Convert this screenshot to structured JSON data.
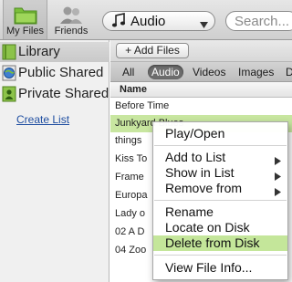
{
  "toolbar": {
    "my_files_label": "My Files",
    "friends_label": "Friends",
    "type_selector_value": "Audio",
    "search_placeholder": "Search..."
  },
  "sidebar": {
    "items": [
      {
        "label": "Library",
        "icon": "library-icon",
        "selected": true
      },
      {
        "label": "Public Shared",
        "icon": "public-shared-icon",
        "selected": false
      },
      {
        "label": "Private Shared",
        "icon": "private-shared-icon",
        "selected": false
      }
    ],
    "create_list_label": "Create List"
  },
  "main": {
    "add_files_label": "+ Add Files",
    "filter_tabs": [
      {
        "label": "All",
        "active": false
      },
      {
        "label": "Audio",
        "active": true
      },
      {
        "label": "Videos",
        "active": false
      },
      {
        "label": "Images",
        "active": false
      },
      {
        "label": "D",
        "active": false
      }
    ],
    "column_header": "Name",
    "files": [
      {
        "name": "Before Time",
        "selected": false
      },
      {
        "name": "Junkyard Blues",
        "selected": true
      },
      {
        "name": "things",
        "selected": false
      },
      {
        "name": "Kiss To",
        "selected": false
      },
      {
        "name": "Frame",
        "selected": false
      },
      {
        "name": "Europa",
        "selected": false
      },
      {
        "name": "Lady o",
        "selected": false
      },
      {
        "name": "02 A D",
        "selected": false
      },
      {
        "name": "04 Zoo",
        "selected": false
      }
    ]
  },
  "context_menu": {
    "items": [
      {
        "label": "Play/Open",
        "submenu": false,
        "highlighted": false
      },
      {
        "label": "Add to List",
        "submenu": true,
        "highlighted": false
      },
      {
        "label": "Show in List",
        "submenu": true,
        "highlighted": false
      },
      {
        "label": "Remove from",
        "submenu": true,
        "highlighted": false
      },
      {
        "label": "Rename",
        "submenu": false,
        "highlighted": false
      },
      {
        "label": "Locate on Disk",
        "submenu": false,
        "highlighted": false
      },
      {
        "label": "Delete from Disk",
        "submenu": false,
        "highlighted": true
      },
      {
        "label": "View File Info...",
        "submenu": false,
        "highlighted": false
      }
    ]
  },
  "colors": {
    "selection_green": "#c8e6a0",
    "menu_highlight": "#c4e69a",
    "link_blue": "#1f4ea1",
    "active_tab_bg": "#6c6c6c"
  }
}
